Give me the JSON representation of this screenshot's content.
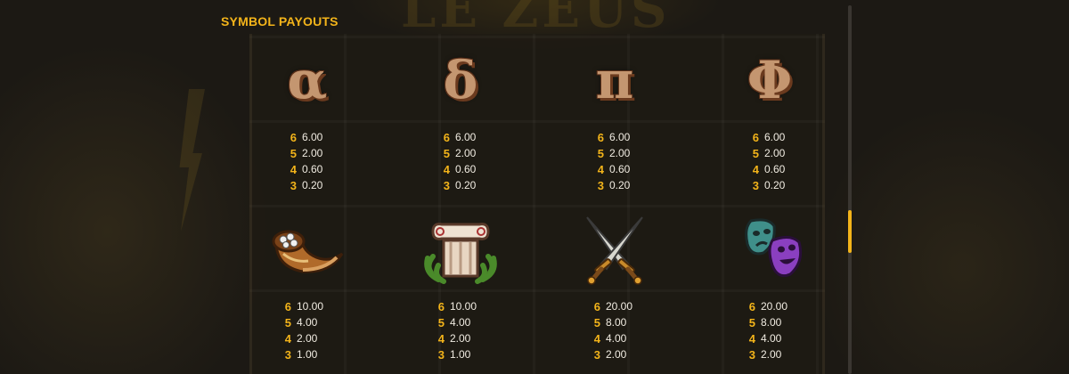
{
  "title": "SYMBOL PAYOUTS",
  "colors": {
    "accent": "#f3b41a",
    "text": "#f1ece2",
    "symbol_fill": "#c49670"
  },
  "symbols": [
    {
      "name": "alpha-symbol",
      "glyph": "α",
      "payouts": [
        {
          "count": "6",
          "value": "6.00"
        },
        {
          "count": "5",
          "value": "2.00"
        },
        {
          "count": "4",
          "value": "0.60"
        },
        {
          "count": "3",
          "value": "0.20"
        }
      ]
    },
    {
      "name": "delta-symbol",
      "glyph": "δ",
      "payouts": [
        {
          "count": "6",
          "value": "6.00"
        },
        {
          "count": "5",
          "value": "2.00"
        },
        {
          "count": "4",
          "value": "0.60"
        },
        {
          "count": "3",
          "value": "0.20"
        }
      ]
    },
    {
      "name": "pi-symbol",
      "glyph": "π",
      "payouts": [
        {
          "count": "6",
          "value": "6.00"
        },
        {
          "count": "5",
          "value": "2.00"
        },
        {
          "count": "4",
          "value": "0.60"
        },
        {
          "count": "3",
          "value": "0.20"
        }
      ]
    },
    {
      "name": "phi-symbol",
      "glyph": "Φ",
      "payouts": [
        {
          "count": "6",
          "value": "6.00"
        },
        {
          "count": "5",
          "value": "2.00"
        },
        {
          "count": "4",
          "value": "0.60"
        },
        {
          "count": "3",
          "value": "0.20"
        }
      ]
    },
    {
      "name": "horn-icon",
      "payouts": [
        {
          "count": "6",
          "value": "10.00"
        },
        {
          "count": "5",
          "value": "4.00"
        },
        {
          "count": "4",
          "value": "2.00"
        },
        {
          "count": "3",
          "value": "1.00"
        }
      ]
    },
    {
      "name": "column-laurel-icon",
      "payouts": [
        {
          "count": "6",
          "value": "10.00"
        },
        {
          "count": "5",
          "value": "4.00"
        },
        {
          "count": "4",
          "value": "2.00"
        },
        {
          "count": "3",
          "value": "1.00"
        }
      ]
    },
    {
      "name": "crossed-swords-icon",
      "payouts": [
        {
          "count": "6",
          "value": "20.00"
        },
        {
          "count": "5",
          "value": "8.00"
        },
        {
          "count": "4",
          "value": "4.00"
        },
        {
          "count": "3",
          "value": "2.00"
        }
      ]
    },
    {
      "name": "theatre-masks-icon",
      "payouts": [
        {
          "count": "6",
          "value": "20.00"
        },
        {
          "count": "5",
          "value": "8.00"
        },
        {
          "count": "4",
          "value": "4.00"
        },
        {
          "count": "3",
          "value": "2.00"
        }
      ]
    }
  ]
}
